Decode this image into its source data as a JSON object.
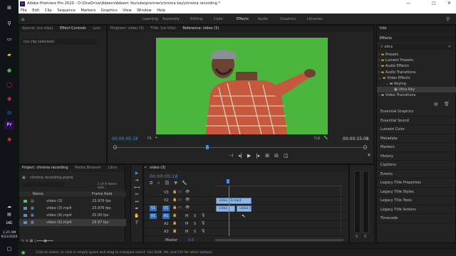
{
  "os": {
    "clock_time": "1:25 AM",
    "clock_date": "9/21/2020",
    "lang": "ENG"
  },
  "app": {
    "title": "Adobe Premiere Pro 2020 - D:\\OneDrive\\Adeem\\Adeem Youtube\\premier\\chroma key\\chroma recording *",
    "menu": [
      "File",
      "Edit",
      "Clip",
      "Sequence",
      "Markers",
      "Graphics",
      "View",
      "Window",
      "Help"
    ],
    "workspaces": [
      "Learning",
      "Assembly",
      "Editing",
      "Color",
      "Effects",
      "Audio",
      "Graphics",
      "Libraries"
    ]
  },
  "source_panel": {
    "tabs": [
      "Source: (no clips)",
      "Effect Controls",
      "Lum"
    ],
    "subheader": "(no clip selected)"
  },
  "program_panel": {
    "tabs": [
      "Program: video (3)",
      "Title: (no title)",
      "Reference: video (3)"
    ],
    "timecode": "00:00:05:18",
    "duration": "00:00:15:08",
    "fit": "Fit",
    "quality": "Full",
    "playhead_fraction": 0.37
  },
  "project_panel": {
    "tabs": [
      "Project: chroma recording",
      "Media Browser",
      "Libra"
    ],
    "file": "chroma recording.prproj",
    "count": "1 of 4 items sele...",
    "columns": {
      "name": "Name",
      "rate": "Frame Rate"
    },
    "items": [
      {
        "name": "video (3)",
        "rate": "23.976 fps",
        "color": "#5fbf5f"
      },
      {
        "name": "video (3).mp4",
        "rate": "23.976 fps",
        "color": "#5b8fd1"
      },
      {
        "name": "video (4).mp4",
        "rate": "25.00 fps",
        "color": "#5b8fd1"
      },
      {
        "name": "video (5).mp4",
        "rate": "29.97 fps",
        "color": "#5b8fd1"
      }
    ]
  },
  "timeline": {
    "tab": "video (3)",
    "timecode": "00:00:05:18",
    "tracks": [
      "V3",
      "V2",
      "V1",
      "A1",
      "A2",
      "A3"
    ],
    "master_label": "Master",
    "master_value": "0.0",
    "clip_top": "video (3).mp4",
    "clip_bottom_a": "video (",
    "clip_bottom_b": "video (",
    "m_label": "M",
    "s_label": "S"
  },
  "info_panel": {
    "title": "Info",
    "effects_title": "Effects",
    "search_value": "ultra",
    "tree": [
      {
        "label": "Presets",
        "indent": 0
      },
      {
        "label": "Lumetri Presets",
        "indent": 0
      },
      {
        "label": "Audio Effects",
        "indent": 0
      },
      {
        "label": "Audio Transitions",
        "indent": 0
      },
      {
        "label": "Video Effects",
        "indent": 0
      },
      {
        "label": "Keying",
        "indent": 1
      },
      {
        "label": "Ultra Key",
        "indent": 2
      },
      {
        "label": "Video Transitions",
        "indent": 0
      }
    ],
    "panels": [
      "Essential Graphics",
      "Essential Sound",
      "Lumetri Color",
      "Metadata",
      "Markers",
      "History",
      "Captions",
      "Events",
      "Legacy Title Properties",
      "Legacy Title Styles",
      "Legacy Title Tools",
      "Legacy Title Actions",
      "Timecode"
    ]
  },
  "status_bar": {
    "text": "Click to select, or click in empty space and drag to marquee select. Use Shift, Alt, and Ctrl for other options."
  }
}
